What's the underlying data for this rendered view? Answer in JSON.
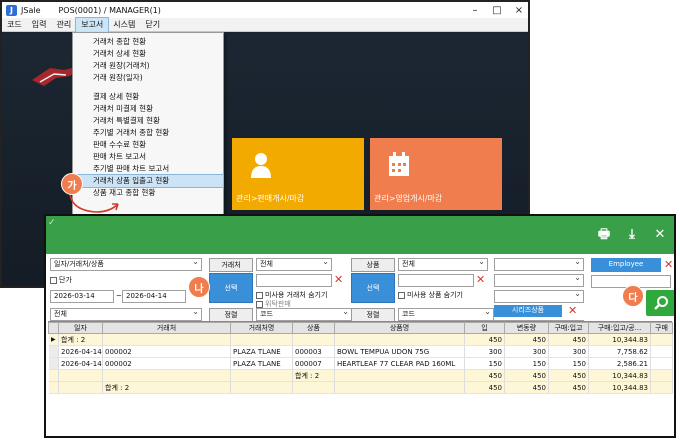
{
  "back": {
    "app_name": "JSale",
    "title": "POS(0001) / MANAGER(1)",
    "menu": [
      "코드",
      "입력",
      "관리",
      "보고서",
      "시스템",
      "닫기"
    ],
    "dropdown_group1": [
      "거래처 종합 현황",
      "거래처 상세 현황",
      "거래 원장(거래처)",
      "거래 원장(일자)"
    ],
    "dropdown_group2": [
      "결제 상세 현황",
      "거래처 미결제 현황",
      "거래처 특별결제 현황",
      "주기별 거래처 종합 현황",
      "판매 수수료 현황",
      "판매 차트 보고서",
      "주기별 판매 차트 보고서",
      "거래처 상품 입출고 현황",
      "상품 재고 종합 현황"
    ],
    "tiles": {
      "sales": "관리>판매개시/마감",
      "business": "관리>영업개시/마감"
    }
  },
  "callouts": {
    "ga": "가",
    "na": "나",
    "da": "다"
  },
  "filters": {
    "group_select": "일자/거래처/상품",
    "single_check": "단가",
    "date_from": "2026-03-14",
    "date_sep": "~",
    "date_to": "2026-04-14",
    "scope_select": "전체",
    "customer_label": "거래처",
    "customer_select": "전체",
    "select_btn": "선택",
    "hide_unused_customer": "미사용 거래처 숨기기",
    "consign_sale": "위탁판매",
    "sort_label": "정렬",
    "sort_select": "코드",
    "product_label": "상품",
    "product_select": "전체",
    "product_select_btn": "선택",
    "hide_unused_product": "미사용 상품 숨기기",
    "series_product_btn": "시리즈상품",
    "sort_label2": "정렬",
    "sort_select2": "코드",
    "employee_btn": "Employee"
  },
  "table": {
    "headers": [
      "일자",
      "거래처",
      "거래처명",
      "상품",
      "상품명",
      "입",
      "변동량",
      "구매:입고",
      "구매:입고/공...",
      "구매"
    ],
    "rows": [
      {
        "type": "total",
        "cells": [
          "합계 : 2",
          "",
          "",
          "",
          "",
          "450",
          "450",
          "450",
          "10,344.83",
          ""
        ]
      },
      {
        "type": "data",
        "cells": [
          "2026-04-14",
          "000002",
          "PLAZA TLANE",
          "000003",
          "BOWL TEMPUA UDON 75G",
          "300",
          "300",
          "300",
          "7,758.62",
          ""
        ]
      },
      {
        "type": "data",
        "cells": [
          "2026-04-14",
          "000002",
          "PLAZA TLANE",
          "000007",
          "HEARTLEAF 77  CLEAR PAD 160ML",
          "150",
          "150",
          "150",
          "2,586.21",
          ""
        ]
      },
      {
        "type": "total",
        "cells": [
          "",
          "",
          "",
          "합계 : 2",
          "",
          "450",
          "450",
          "450",
          "10,344.83",
          ""
        ]
      },
      {
        "type": "total",
        "cells": [
          "",
          "합계 : 2",
          "",
          "",
          "",
          "450",
          "450",
          "450",
          "10,344.83",
          ""
        ]
      }
    ]
  },
  "colors": {
    "header_green": "#3a9f49",
    "accent_blue": "#3a8fd9",
    "tile_orange": "#f2a900",
    "tile_coral": "#ef7d4e",
    "callout": "#ef7d4e"
  }
}
